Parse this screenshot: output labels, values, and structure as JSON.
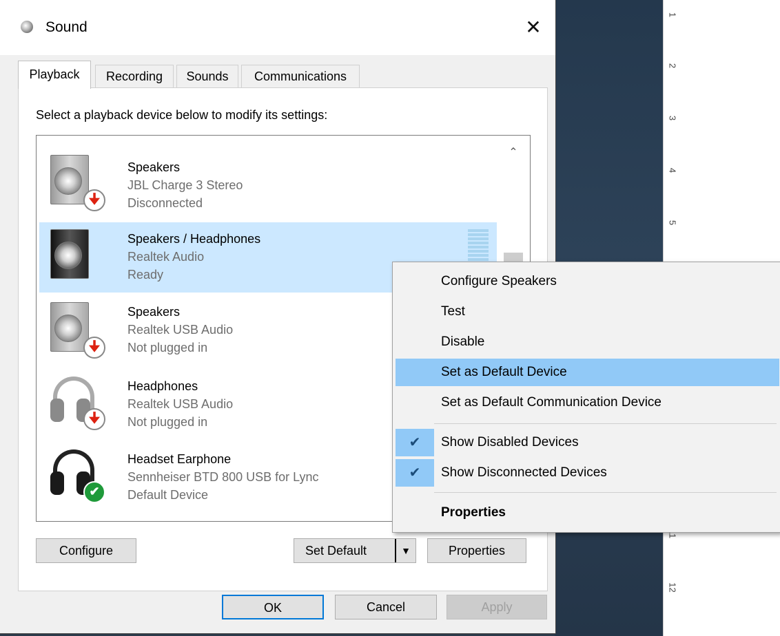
{
  "window": {
    "title": "Sound",
    "close_glyph": "✕"
  },
  "tabs": [
    {
      "label": "Playback",
      "active": true
    },
    {
      "label": "Recording"
    },
    {
      "label": "Sounds"
    },
    {
      "label": "Communications"
    }
  ],
  "instruction": "Select a playback device below to modify its settings:",
  "devices": [
    {
      "name": "Speakers",
      "line1": "JBL Charge 3 Stereo",
      "line2": "Disconnected",
      "icon": "speaker-icon",
      "status": "disconnected"
    },
    {
      "name": "Speakers / Headphones",
      "line1": "Realtek Audio",
      "line2": "Ready",
      "icon": "speaker-icon",
      "status": "ready",
      "selected": true
    },
    {
      "name": "Speakers",
      "line1": "Realtek USB Audio",
      "line2": "Not plugged in",
      "icon": "speaker-icon",
      "status": "unplugged"
    },
    {
      "name": "Headphones",
      "line1": "Realtek USB Audio",
      "line2": "Not plugged in",
      "icon": "headphones-icon",
      "status": "unplugged"
    },
    {
      "name": "Headset Earphone",
      "line1": "Sennheiser BTD 800 USB for Lync",
      "line2": "Default Device",
      "icon": "headset-icon",
      "status": "default"
    }
  ],
  "buttons": {
    "configure": "Configure",
    "set_default": "Set Default",
    "properties": "Properties",
    "ok": "OK",
    "cancel": "Cancel",
    "apply": "Apply"
  },
  "context_menu": {
    "items": [
      {
        "label": "Configure Speakers"
      },
      {
        "label": "Test"
      },
      {
        "label": "Disable"
      },
      {
        "label": "Set as Default Device",
        "highlighted": true
      },
      {
        "label": "Set as Default Communication Device"
      },
      {
        "label": "Show Disabled Devices",
        "checked": true
      },
      {
        "label": "Show Disconnected Devices",
        "checked": true
      },
      {
        "label": "Properties",
        "bold": true
      }
    ]
  },
  "ruler": {
    "marks": [
      "1",
      "2",
      "3",
      "4",
      "5",
      "11",
      "12"
    ]
  },
  "colors": {
    "selection": "#cce8ff",
    "menu_highlight": "#91c9f7",
    "primary_border": "#0078d7"
  }
}
